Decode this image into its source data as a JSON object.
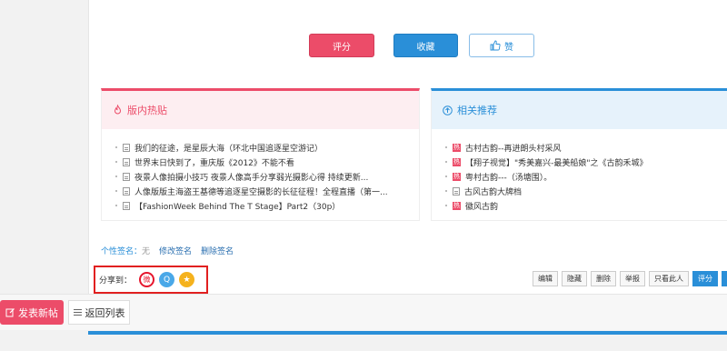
{
  "vote": {
    "rate_label": "评分",
    "favorite_label": "收藏",
    "like_label": "赞"
  },
  "hot_panel": {
    "title": "版内热贴",
    "items": [
      "我们的征途，是星辰大海（环北中国追逐星空游记）",
      "世界末日快到了，重庆版《2012》不能不看",
      "夜景人像拍摄小技巧 夜景人像高手分享弱光摄影心得 持续更新...",
      "人像版版主海盗王基德等追逐星空摄影的长征征程！全程直播（第一...",
      "【FashionWeek Behind The T Stage】Part2（30p）"
    ]
  },
  "rec_panel": {
    "title": "相关推荐",
    "items": [
      {
        "text": "古村古韵--再进朗头村采风",
        "icon": "hot"
      },
      {
        "text": "【翔子视觉】\"秀美嘉兴-最美船娘\"之《古韵禾城》",
        "icon": "hot"
      },
      {
        "text": "粤村古韵---（汤塘围）。",
        "icon": "hot"
      },
      {
        "text": "古风古韵大牌档",
        "icon": "doc"
      },
      {
        "text": "徽风古韵",
        "icon": "hot"
      }
    ]
  },
  "signature": {
    "label": "个性签名：",
    "value": "无",
    "edit": "修改签名",
    "delete": "删除签名"
  },
  "share": {
    "label": "分享到："
  },
  "actions": [
    "编辑",
    "隐藏",
    "删除",
    "举报",
    "只看此人",
    "评分"
  ],
  "bottom": {
    "post_label": "发表新帖",
    "back_label": "返回列表"
  },
  "colors": {
    "accent_pink": "#ec4c69",
    "accent_blue": "#2a8fd8"
  }
}
